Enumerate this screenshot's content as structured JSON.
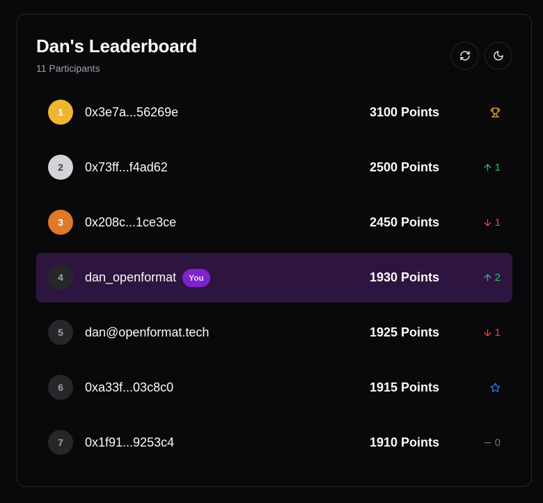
{
  "header": {
    "title": "Dan's Leaderboard",
    "subtitle": "11 Participants"
  },
  "icons": {
    "refresh": "refresh-icon",
    "theme": "moon-icon"
  },
  "entries": [
    {
      "rank": "1",
      "name": "0x3e7a...56269e",
      "points": "3100 Points",
      "status": "trophy",
      "change": ""
    },
    {
      "rank": "2",
      "name": "0x73ff...f4ad62",
      "points": "2500 Points",
      "status": "up",
      "change": "1"
    },
    {
      "rank": "3",
      "name": "0x208c...1ce3ce",
      "points": "2450 Points",
      "status": "down",
      "change": "1"
    },
    {
      "rank": "4",
      "name": "dan_openformat",
      "badge": "You",
      "points": "1930 Points",
      "status": "up",
      "change": "2"
    },
    {
      "rank": "5",
      "name": "dan@openformat.tech",
      "points": "1925 Points",
      "status": "down",
      "change": "1"
    },
    {
      "rank": "6",
      "name": "0xa33f...03c8c0",
      "points": "1915 Points",
      "status": "star",
      "change": ""
    },
    {
      "rank": "7",
      "name": "0x1f91...9253c4",
      "points": "1910 Points",
      "status": "same",
      "change": "0"
    }
  ],
  "colors": {
    "gold": "#f0b530",
    "silver": "#d4d4d8",
    "bronze": "#e0782a",
    "highlight": "#2e1540",
    "badge": "#7e22ce",
    "up": "#22c55e",
    "down": "#ef4444",
    "star": "#3b82f6"
  }
}
